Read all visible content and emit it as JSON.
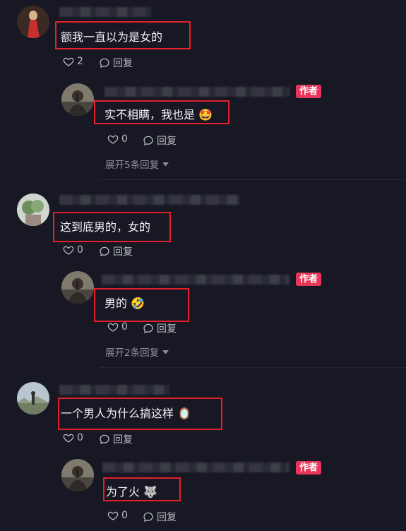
{
  "author_badge": "作者",
  "reply_label": "回复",
  "comments": [
    {
      "text": "额我一直以为是女的",
      "likes": "2",
      "reply": {
        "text": "实不相瞒，我也是",
        "emoji": "🤩",
        "likes": "0"
      },
      "expand": "展开5条回复"
    },
    {
      "text": "这到底男的，女的",
      "likes": "0",
      "reply": {
        "text": "男的",
        "emoji": "🤣",
        "likes": "0"
      },
      "expand": "展开2条回复"
    },
    {
      "text": "一个男人为什么搞这样",
      "emoji": "🪞",
      "likes": "0",
      "reply": {
        "text": "为了火",
        "emoji": "🐺",
        "likes": "0"
      }
    }
  ],
  "colors": {
    "background": "#171823",
    "highlight_box": "#e3202b",
    "author_badge": "#e8365a"
  }
}
